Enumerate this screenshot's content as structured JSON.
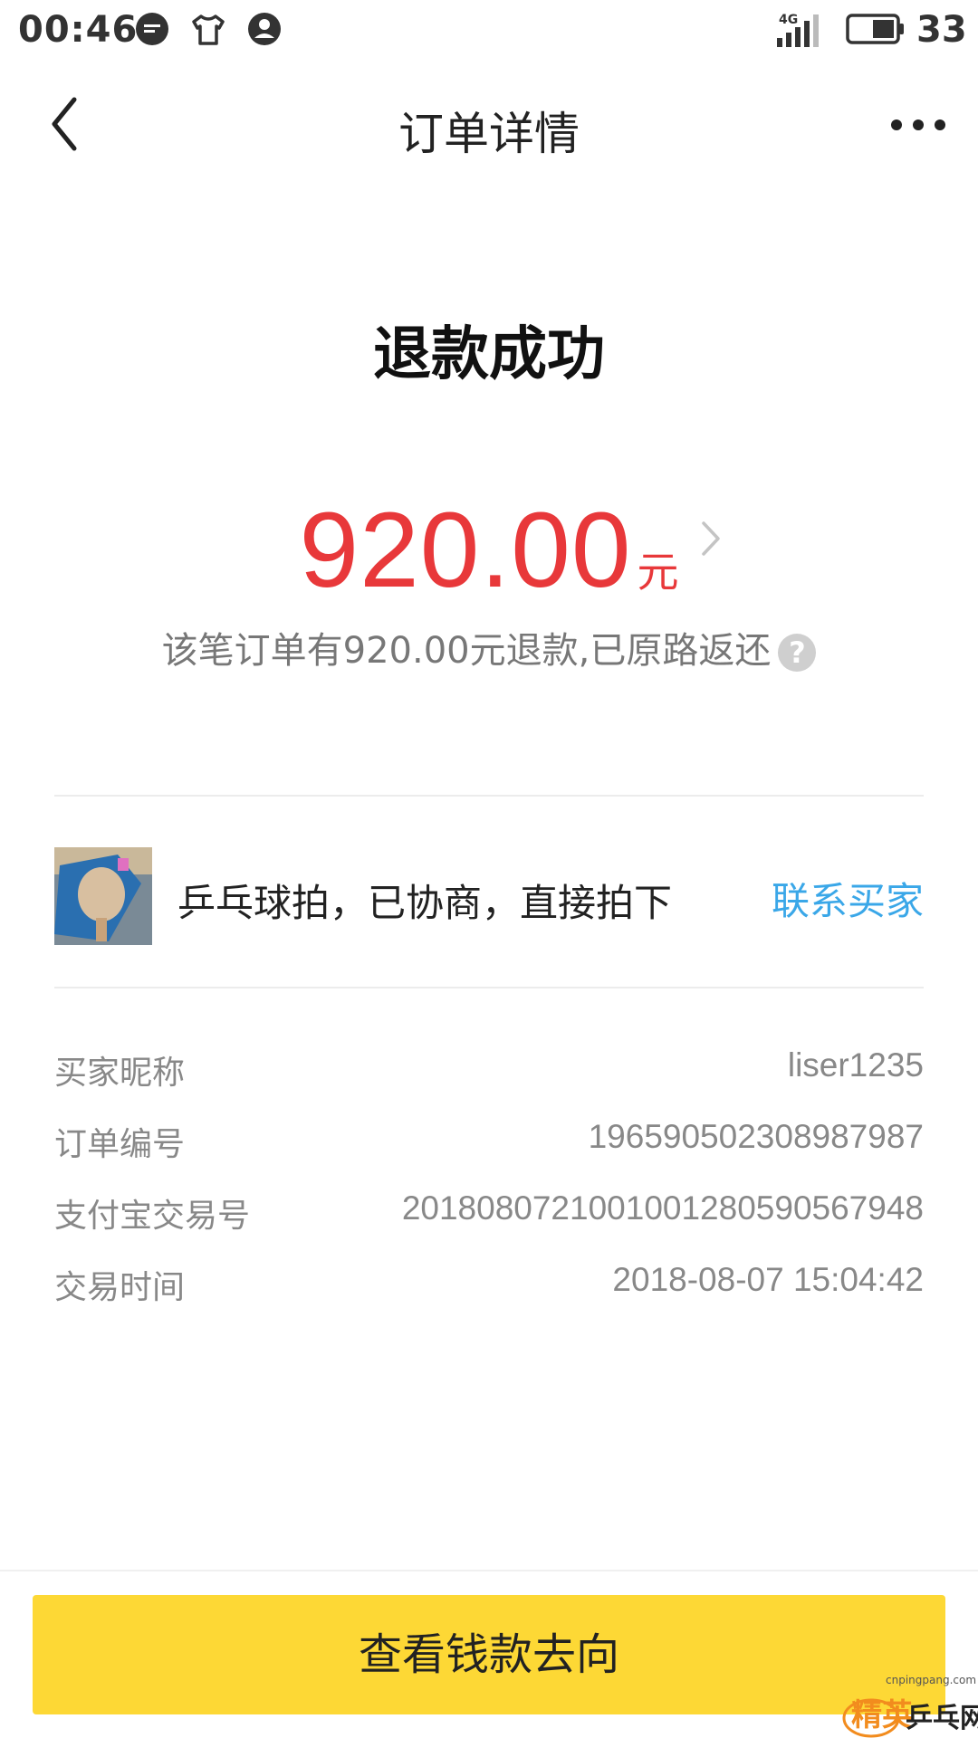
{
  "status_bar": {
    "time": "00:46",
    "network": "4G",
    "battery": "33",
    "icons": [
      "message-icon",
      "shirt-icon",
      "account-icon",
      "signal-icon",
      "battery-icon"
    ]
  },
  "nav": {
    "title": "订单详情",
    "back_icon": "chevron-left-icon",
    "more_icon": "more-dots-icon"
  },
  "refund": {
    "status": "退款成功",
    "amount": "920.00",
    "unit": "元",
    "note": "该笔订单有920.00元退款,已原路返还",
    "help_icon": "?"
  },
  "product": {
    "title": "乒乓球拍，已协商，直接拍下",
    "contact_label": "联系买家"
  },
  "details": [
    {
      "label": "买家昵称",
      "value": "liser1235"
    },
    {
      "label": "订单编号",
      "value": "196590502308987987"
    },
    {
      "label": "支付宝交易号",
      "value": "2018080721001001280590567948"
    },
    {
      "label": "交易时间",
      "value": "2018-08-07 15:04:42"
    }
  ],
  "footer": {
    "button_label": "查看钱款去向"
  },
  "watermark": {
    "text_main": "精英乒乓网",
    "text_url": "cnpingpang.com"
  },
  "colors": {
    "accent_red": "#e8383a",
    "link_blue": "#3aa7e8",
    "button_yellow": "#fdd835"
  }
}
